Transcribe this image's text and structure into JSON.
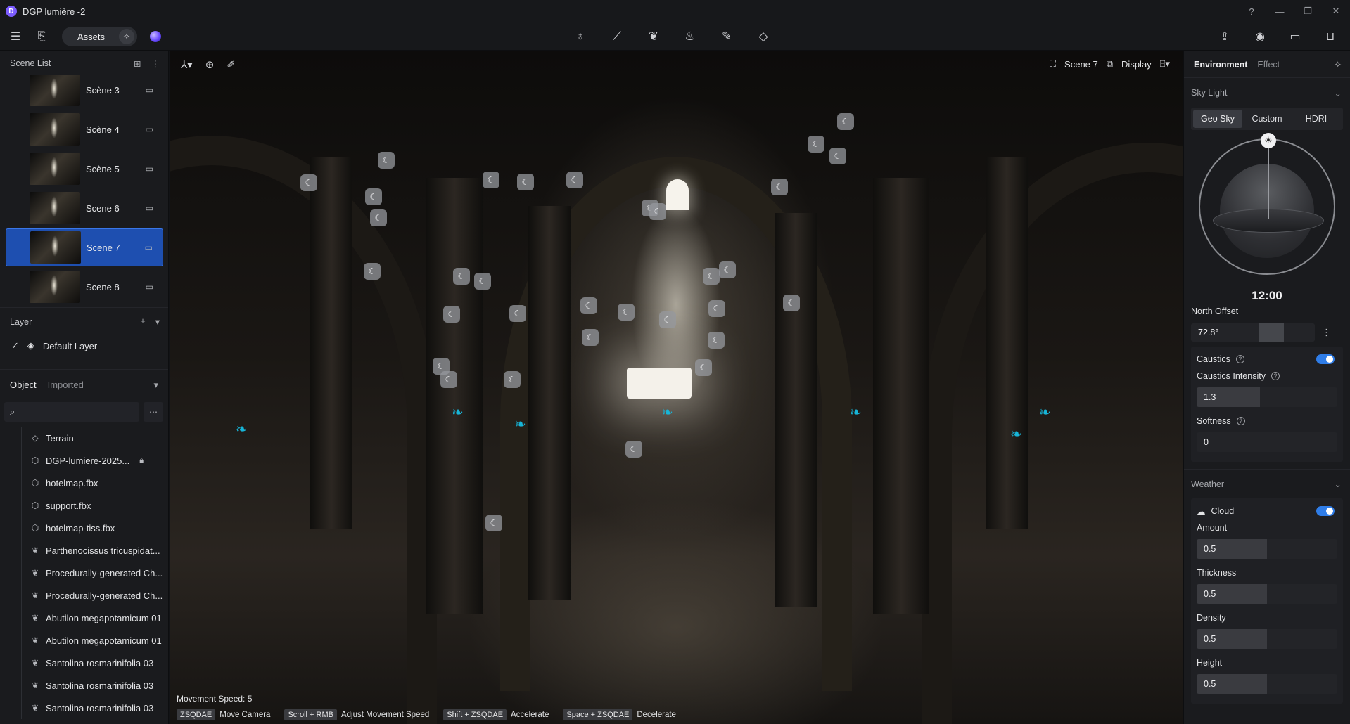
{
  "window": {
    "title": "DGP lumière -2",
    "logo_letter": "D"
  },
  "toolbar": {
    "assets_label": "Assets"
  },
  "scene_list": {
    "title": "Scene List",
    "scenes": [
      {
        "name": "Scène 3",
        "active": false
      },
      {
        "name": "Scène 4",
        "active": false
      },
      {
        "name": "Scène 5",
        "active": false
      },
      {
        "name": "Scene 6",
        "active": false
      },
      {
        "name": "Scene 7",
        "active": true
      },
      {
        "name": "Scene 8",
        "active": false
      }
    ]
  },
  "layer": {
    "title": "Layer",
    "default_layer": "Default Layer"
  },
  "objects": {
    "tab_object": "Object",
    "tab_imported": "Imported",
    "search_placeholder": "",
    "items": [
      {
        "name": "Terrain",
        "icon": "terrain-icon"
      },
      {
        "name": "DGP-lumiere-2025...",
        "icon": "cube-icon",
        "locked": true
      },
      {
        "name": "hotelmap.fbx",
        "icon": "cube-icon"
      },
      {
        "name": "support.fbx",
        "icon": "cube-icon"
      },
      {
        "name": "hotelmap-tiss.fbx",
        "icon": "cube-icon"
      },
      {
        "name": "Parthenocissus tricuspidat...",
        "icon": "leaf-icon"
      },
      {
        "name": "Procedurally-generated Ch...",
        "icon": "leaf-icon"
      },
      {
        "name": "Procedurally-generated Ch...",
        "icon": "leaf-icon"
      },
      {
        "name": "Abutilon megapotamicum 01",
        "icon": "leaf-icon"
      },
      {
        "name": "Abutilon megapotamicum 01",
        "icon": "leaf-icon"
      },
      {
        "name": "Santolina rosmarinifolia 03",
        "icon": "leaf-icon"
      },
      {
        "name": "Santolina rosmarinifolia 03",
        "icon": "leaf-icon"
      },
      {
        "name": "Santolina rosmarinifolia 03",
        "icon": "leaf-icon"
      }
    ]
  },
  "viewport": {
    "scene_label": "Scene 7",
    "display_label": "Display",
    "movement_speed": "Movement Speed: 5",
    "hints": [
      {
        "key": "ZSQDAE",
        "label": "Move Camera"
      },
      {
        "key": "Scroll + RMB",
        "label": "Adjust Movement Speed"
      },
      {
        "key": "Shift + ZSQDAE",
        "label": "Accelerate"
      },
      {
        "key": "Space + ZSQDAE",
        "label": "Decelerate"
      }
    ]
  },
  "environment": {
    "tab_environment": "Environment",
    "tab_effect": "Effect",
    "sky_light": {
      "title": "Sky Light",
      "modes": [
        "Geo Sky",
        "Custom",
        "HDRI"
      ],
      "active_mode": "Geo Sky",
      "time": "12:00",
      "north_offset_label": "North Offset",
      "north_offset": "72.8°"
    },
    "caustics": {
      "label": "Caustics",
      "enabled": true,
      "intensity_label": "Caustics Intensity",
      "intensity": "1.3",
      "intensity_fraction": 0.45,
      "softness_label": "Softness",
      "softness": "0",
      "softness_fraction": 0
    },
    "weather": {
      "title": "Weather",
      "cloud_label": "Cloud",
      "cloud_enabled": true,
      "params": [
        {
          "label": "Amount",
          "value": "0.5",
          "fraction": 0.5
        },
        {
          "label": "Thickness",
          "value": "0.5",
          "fraction": 0.5
        },
        {
          "label": "Density",
          "value": "0.5",
          "fraction": 0.5
        },
        {
          "label": "Height",
          "value": "0.5",
          "fraction": 0.5
        }
      ]
    }
  },
  "colors": {
    "accent": "#2f7de8",
    "active_row": "#1e4fb0",
    "plant_marker": "#17b5d8"
  }
}
